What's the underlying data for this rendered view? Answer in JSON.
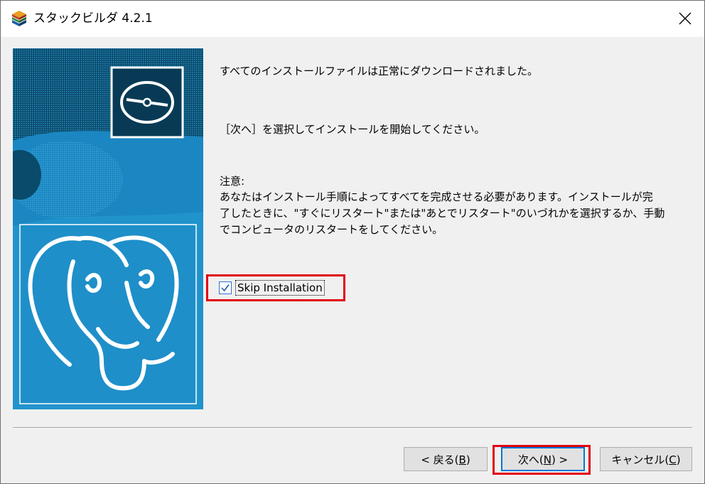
{
  "window": {
    "title": "スタックビルダ 4.2.1",
    "icon": "stackbuilder-cubes-icon",
    "close_icon": "close-icon"
  },
  "banner": {
    "disc_icon": "disc-icon",
    "logo": "postgresql-elephant-logo",
    "colors": {
      "dark": "#0b4665",
      "mid": "#1f7fb0",
      "light": "#2595cf"
    }
  },
  "content": {
    "message1": "すべてのインストールファイルは正常にダウンロードされました。",
    "message2": "［次へ］を選択してインストールを開始してください。",
    "note_title": "注意:",
    "note_line1": "あなたはインストール手順によってすべてを完成させる必要があります。インストールが完",
    "note_line2": "了したときに、\"すぐにリスタート\"または\"あとでリスタート\"のいづれかを選択するか、手動",
    "note_line3": "でコンピュータのリスタートをしてください。"
  },
  "skip": {
    "label": "Skip Installation",
    "checked": true
  },
  "buttons": {
    "back_prefix": "< 戻る(",
    "back_key": "B",
    "back_suffix": ")",
    "next_prefix": "次へ(",
    "next_key": "N",
    "next_suffix": ") >",
    "cancel_prefix": "キャンセル(",
    "cancel_key": "C",
    "cancel_suffix": ")"
  },
  "colors": {
    "highlight": "#e10010",
    "focus": "#0078d7"
  }
}
